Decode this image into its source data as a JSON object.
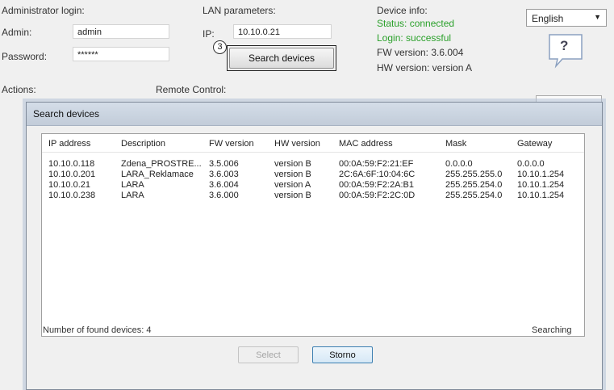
{
  "login": {
    "heading": "Administrator login:",
    "admin_label": "Admin:",
    "admin_value": "admin",
    "password_label": "Password:",
    "password_value": "******"
  },
  "lan": {
    "heading": "LAN parameters:",
    "ip_label": "IP:",
    "ip_value": "10.10.0.21",
    "search_button": "Search devices",
    "callout": "3"
  },
  "device_info": {
    "heading": "Device info:",
    "status": "Status: connected",
    "login_status": "Login: successful",
    "fw": "FW version: 3.6.004",
    "hw": "HW version: version A",
    "status_color": "#2aa02a"
  },
  "language": {
    "selected": "English"
  },
  "help": {
    "label": "?"
  },
  "main": {
    "actions_label": "Actions:",
    "remote_label": "Remote Control:"
  },
  "dialog": {
    "title": "Search devices",
    "columns": [
      "IP address",
      "Description",
      "FW version",
      "HW version",
      "MAC address",
      "Mask",
      "Gateway"
    ],
    "rows": [
      [
        "10.10.0.118",
        "Zdena_PROSTRE...",
        "3.5.006",
        "version B",
        "00:0A:59:F2:21:EF",
        "0.0.0.0",
        "0.0.0.0"
      ],
      [
        "10.10.0.201",
        "LARA_Reklamace",
        "3.6.003",
        "version B",
        "2C:6A:6F:10:04:6C",
        "255.255.255.0",
        "10.10.1.254"
      ],
      [
        "10.10.0.21",
        "LARA",
        "3.6.004",
        "version A",
        "00:0A:59:F2:2A:B1",
        "255.255.254.0",
        "10.10.1.254"
      ],
      [
        "10.10.0.238",
        "LARA",
        "3.6.000",
        "version B",
        "00:0A:59:F2:2C:0D",
        "255.255.254.0",
        "10.10.1.254"
      ]
    ],
    "found_text": "Number of found devices: 4",
    "searching_text": "Searching",
    "select_button": "Select",
    "cancel_button": "Storno"
  }
}
